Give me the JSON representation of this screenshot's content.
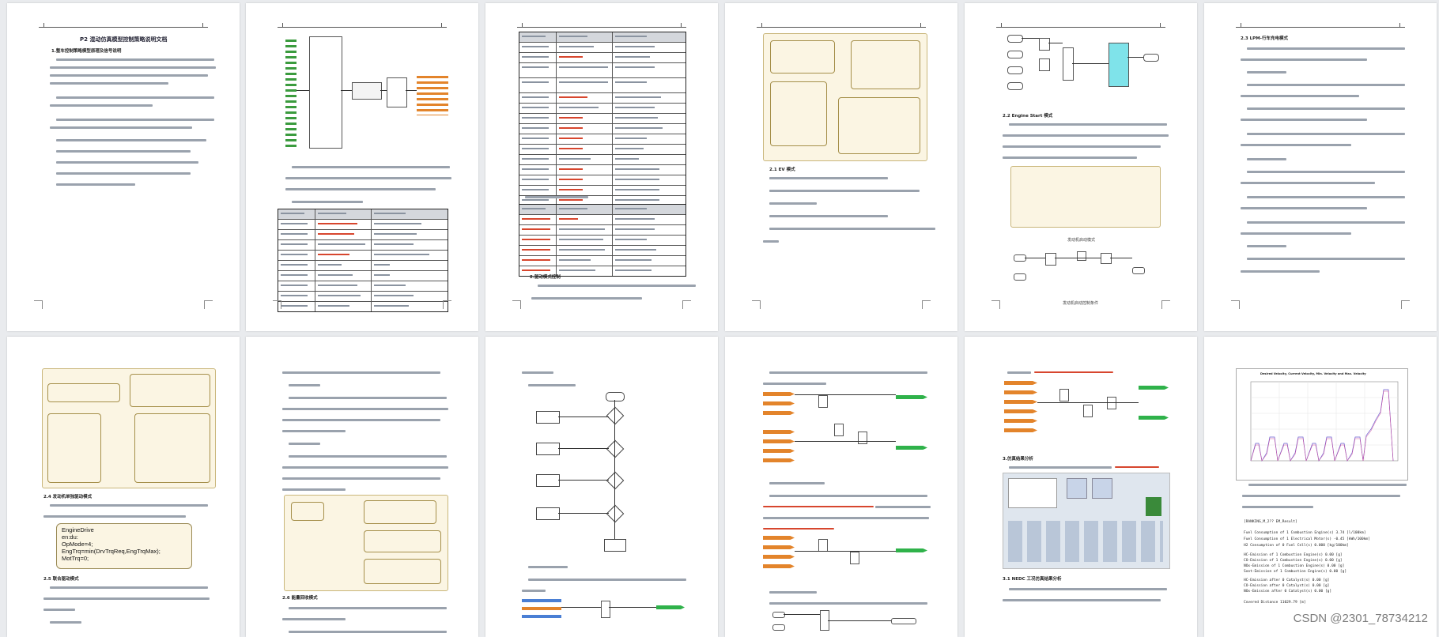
{
  "document": {
    "title": "P2 混动仿真模型控制策略说明文档",
    "sections": {
      "s1": "1.整车控制策略模型原理及信号说明",
      "s2": "2.驱动模式控制",
      "s21": "2.1 EV 模式",
      "s22": "2.2 Engine Start 模式",
      "s23": "2.3 LPM-行车充电模式",
      "s24": "2.4 发动机单独驱动模式",
      "s25": "2.5 联合驱动模式",
      "s26": "2.6 能量回收模式",
      "s3": "3.仿真结果分析",
      "s31": "3.1 NEDC 工况仿真结果分析"
    },
    "captions": {
      "engine_sub": "发动机启动模式",
      "engine_ctrl": "发动机启动控制条件",
      "brake_intro": "驱动模式切换"
    },
    "state_box_lines": [
      "EngineDrive",
      "en:du:",
      "OpMode=4;",
      "EngTrq=min(DrvTrqReq,EngTrqMax);",
      "MotTrq=0;"
    ],
    "table_input": {
      "header": [
        "信号来源",
        "信号名称",
        "信号描述"
      ],
      "rows": [
        [
          "CRUISE 输入",
          "Clutch Torque",
          "发动机扭矩"
        ],
        [
          "CRUISE 输入",
          "Brake Pressure",
          "制动压力"
        ],
        [
          "CRUISE 输入",
          "Accelerator Pedal Travel",
          "加速踏板开度"
        ],
        [
          "CRUISE 输入",
          "Desired Torque",
          "需求扭矩"
        ],
        [
          "CRUISE 输入",
          "Velocity",
          "车速"
        ],
        [
          "CRUISE 输入",
          "State of Charge",
          "SOC"
        ],
        [
          "CRUISE 输入",
          "Generator Torque",
          "电机扭矩"
        ],
        [
          "CRUISE 输入",
          "Engine Start Speed",
          "发动机启动转速"
        ],
        [
          "CRUISE 输入",
          "Motor Speed",
          "电机转速"
        ]
      ]
    },
    "table_signals": {
      "header": [
        "信号来源",
        "信号名称",
        "信号描述"
      ],
      "rows": [
        [
          "CRUISE 输入",
          "Engine Speed",
          "发动机转速"
        ],
        [
          "CRUISE 输入",
          "Gear",
          "变速箱档位"
        ],
        [
          "CRUISE 输入",
          "Efficiency of Single Ratio Transmission",
          "单级减速器效率"
        ],
        [
          "CRUISE 输入",
          "Transmission Ratio of Single Ratio Transmission",
          "减速器速比"
        ],
        [
          "CRUISE 输入",
          "Motor Speed",
          "电机转速"
        ],
        [
          "CRUISE 输入",
          "Brake Pedal Travel",
          "制动踏板开度"
        ],
        [
          "CRUISE 输入",
          "Max Torque",
          "最大扭矩"
        ],
        [
          "CRUISE 输入",
          "Motor Torque",
          "电机扭矩"
        ],
        [
          "CRUISE 输入",
          "Ratio",
          "速比"
        ],
        [
          "CRUISE 输入",
          "Engine Mode",
          "发动机模式"
        ],
        [
          "CRUISE 输入",
          "Driver Velocity",
          "驾驶车速"
        ],
        [
          "CRUISE 输入",
          "Mode",
          "模式"
        ],
        [
          "CRUISE 输入",
          "Low SOC",
          "低SOC"
        ],
        [
          "CRUISE 输入",
          "Mid SOC",
          "中SOC"
        ],
        [
          "CRUISE 输入",
          "High SOC",
          "高SOC"
        ]
      ]
    },
    "table_output": {
      "header": [
        "信号来源",
        "信号名称",
        "信号描述"
      ],
      "rows": [
        [
          "MATLAB 输出",
          "Clutch",
          "离合状态"
        ],
        [
          "MATLAB 输出",
          "Engine Desired Torque",
          "发动机需求扭矩"
        ],
        [
          "MATLAB 输出",
          "Motor Desired Torque",
          "电机需求扭矩"
        ],
        [
          "MATLAB 输出",
          "Desired Clutch Release",
          "离合器释放"
        ],
        [
          "MATLAB 输出",
          "Engine Start",
          "发动机启动"
        ],
        [
          "MATLAB 输出",
          "Braking Torque",
          "制动扭矩"
        ]
      ]
    },
    "results": {
      "mono_lines": [
        "[RANKING_M_2??  EM_Result]",
        "Fuel Consumption of 1 Combustion Engine(s)   3.74 [l/100km]",
        "Fuel Consumption of 1 Electrical Motor(s)   -0.45 [kWh/100km]",
        "H2 Consumption of 0 Fuel Cell(s)          0.000 [kg/100km]",
        "HC-Emission  of 1 Combustion Engine(s)     0.00 [g]",
        "CO-Emission  of 1 Combustion Engine(s)     0.00 [g]",
        "NOx-Emission of 1 Combustion Engine(s)     0.00 [g]",
        "Soot-Emission of 1 Combustion Engine(s)    0.00 [g]",
        "HC-Emission  after 0 Catalyst(s)            0.00 [g]",
        "CO-Emission  after 0 Catalyst(s)            0.00 [g]",
        "NOx-Emission after 0 Catalyst(s)            0.00 [g]",
        "Covered Distance  11029.79 [m]"
      ]
    },
    "chart_title": "Desired Velocity, Current Velocity, Min. Velocity and Max. Velocity",
    "watermark": "CSDN @2301_78734212",
    "colors": {
      "background": "#e9ebee",
      "page": "#ffffff",
      "signal_in": "#e3842b",
      "signal_out": "#2fb24a",
      "simulink_highlight": "#7fe3ea",
      "stateflow_bg": "#fbf5e3"
    }
  }
}
